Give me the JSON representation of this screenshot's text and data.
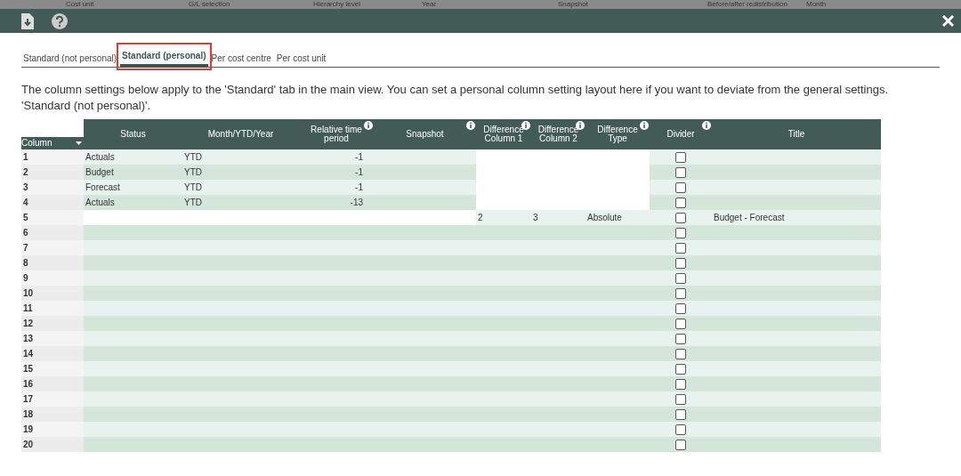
{
  "background_header": [
    "Cost unit",
    "G/L selection",
    "Hierarchy level",
    "Year",
    "Snapshot",
    "Before/after redistribution",
    "Month"
  ],
  "tabs": [
    {
      "label": "Standard (not personal)",
      "selected": false
    },
    {
      "label": "Standard (personal)",
      "selected": true
    },
    {
      "label": "Per cost centre",
      "selected": false
    },
    {
      "label": "Per cost unit",
      "selected": false
    }
  ],
  "description": "The column settings below apply to the 'Standard' tab in the main view. You can set a personal column setting layout here if you want to deviate from the general settings. 'Standard (not personal)'.",
  "table": {
    "columns": [
      {
        "label": "Column",
        "info": false,
        "sortable": true
      },
      {
        "label": "Status",
        "info": false,
        "sortable": false
      },
      {
        "label": "Month/YTD/Year",
        "info": false,
        "sortable": false
      },
      {
        "label": "Relative time period",
        "info": true,
        "sortable": false
      },
      {
        "label": "Snapshot",
        "info": true,
        "sortable": false
      },
      {
        "label": "Difference Column 1",
        "info": true,
        "sortable": false
      },
      {
        "label": "Difference Column 2",
        "info": true,
        "sortable": false
      },
      {
        "label": "Difference Type",
        "info": true,
        "sortable": false
      },
      {
        "label": "Divider",
        "info": true,
        "sortable": false
      },
      {
        "label": "Title",
        "info": false,
        "sortable": false
      }
    ],
    "rows": [
      {
        "kind": "source",
        "column": "1",
        "status": "Actuals",
        "period": "YTD",
        "relative": "-1",
        "divider": false
      },
      {
        "kind": "source",
        "column": "2",
        "status": "Budget",
        "period": "YTD",
        "relative": "-1",
        "divider": false
      },
      {
        "kind": "source",
        "column": "3",
        "status": "Forecast",
        "period": "YTD",
        "relative": "-1",
        "divider": false
      },
      {
        "kind": "source",
        "column": "4",
        "status": "Actuals",
        "period": "YTD",
        "relative": "-13",
        "divider": false
      },
      {
        "kind": "difference",
        "column": "5",
        "diff1": "2",
        "diff2": "3",
        "diff_type": "Absolute",
        "title": "Budget - Forecast",
        "divider": false
      },
      {
        "kind": "empty",
        "column": "6",
        "divider": false
      },
      {
        "kind": "empty",
        "column": "7",
        "divider": false
      },
      {
        "kind": "empty",
        "column": "8",
        "divider": false
      },
      {
        "kind": "empty",
        "column": "9",
        "divider": false
      },
      {
        "kind": "empty",
        "column": "10",
        "divider": false
      },
      {
        "kind": "empty",
        "column": "11",
        "divider": false
      },
      {
        "kind": "empty",
        "column": "12",
        "divider": false
      },
      {
        "kind": "empty",
        "column": "13",
        "divider": false
      },
      {
        "kind": "empty",
        "column": "14",
        "divider": false
      },
      {
        "kind": "empty",
        "column": "15",
        "divider": false
      },
      {
        "kind": "empty",
        "column": "16",
        "divider": false
      },
      {
        "kind": "empty",
        "column": "17",
        "divider": false
      },
      {
        "kind": "empty",
        "column": "18",
        "divider": false
      },
      {
        "kind": "empty",
        "column": "19",
        "divider": false
      },
      {
        "kind": "empty",
        "column": "20",
        "divider": false
      }
    ]
  }
}
